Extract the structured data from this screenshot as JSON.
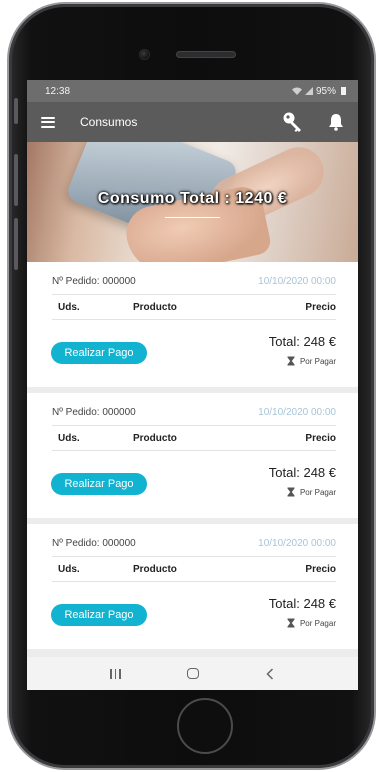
{
  "status_bar": {
    "time": "12:38",
    "battery": "95%"
  },
  "app_bar": {
    "title": "Consumos",
    "icons": [
      "menu-icon",
      "key-icon",
      "bell-icon"
    ]
  },
  "banner": {
    "title": "Consumo Total : 1240 €"
  },
  "orders": [
    {
      "order_label": "Nº Pedido: 000000",
      "date": "10/10/2020 00:00",
      "col_units": "Uds.",
      "col_product": "Producto",
      "col_price": "Precio",
      "pay_button": "Realizar Pago",
      "total": "Total: 248 €",
      "status": "Por Pagar"
    },
    {
      "order_label": "Nº Pedido: 000000",
      "date": "10/10/2020 00:00",
      "col_units": "Uds.",
      "col_product": "Producto",
      "col_price": "Precio",
      "pay_button": "Realizar Pago",
      "total": "Total: 248 €",
      "status": "Por Pagar"
    },
    {
      "order_label": "Nº Pedido: 000000",
      "date": "10/10/2020 00:00",
      "col_units": "Uds.",
      "col_product": "Producto",
      "col_price": "Precio",
      "pay_button": "Realizar Pago",
      "total": "Total: 248 €",
      "status": "Por Pagar"
    }
  ],
  "colors": {
    "app_bar": "#5b5b5b",
    "status_bar": "#6d6d6d",
    "accent_button": "#12b3d1",
    "date_text": "#a7c4d8"
  },
  "nav_bar": {
    "icons": [
      "recents-icon",
      "home-icon",
      "back-icon"
    ]
  }
}
